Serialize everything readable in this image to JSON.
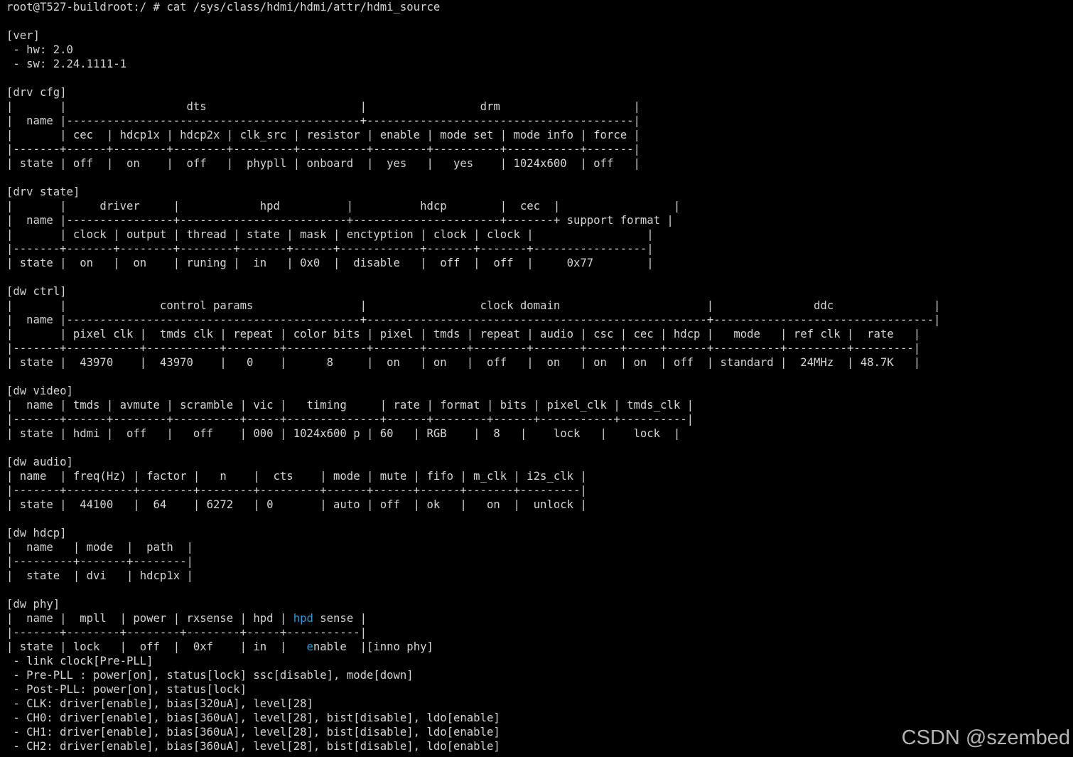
{
  "terminal": {
    "lines": [
      "root@T527-buildroot:/ # cat /sys/class/hdmi/hdmi/attr/hdmi_source",
      "",
      "[ver]",
      " - hw: 2.0",
      " - sw: 2.24.1111-1",
      "",
      "[drv cfg]",
      "|       |                  dts                       |                 drm                    |",
      "|  name |--------------------------------------------+----------------------------------------|",
      "|       | cec  | hdcp1x | hdcp2x | clk_src | resistor | enable | mode set | mode info | force |",
      "|-------+------+--------+--------+---------+----------+--------+----------+-----------+-------|",
      "| state | off  |  on    |  off   |  phypll | onboard  |  yes   |   yes    | 1024x600  | off   |",
      "",
      "[drv state]",
      "|       |     driver     |            hpd          |          hdcp        |  cec  |                 |",
      "|  name |----------------+-------------------------+----------------------+-------+ support format |",
      "|       | clock | output | thread | state | mask | enctyption | clock | clock |                 |",
      "|-------+-------+--------+--------+-------+------+------------+-------+-------+-----------------|",
      "| state |  on   |  on    | runing |  in   | 0x0  |  disable   |  off  |  off  |     0x77        |",
      "",
      "[dw ctrl]",
      "|       |              control params                |                 clock domain                      |               ddc               |",
      "|  name |--------------------------------------------+---------------------------------------------------+---------------------------------|",
      "|       | pixel clk |  tmds clk | repeat | color bits | pixel | tmds | repeat | audio | csc | cec | hdcp |   mode   | ref clk |  rate   |",
      "|-------+-----------+-----------+--------+------------+-------+------+--------+-------+-----+-----+------+----------+---------+---------|",
      "| state |  43970    |  43970    |   0    |      8     |  on   | on   |  off   |  on   | on  | on  | off  | standard |  24MHz  | 48.7K   |",
      "",
      "[dw video]",
      "|  name | tmds | avmute | scramble | vic |   timing     | rate | format | bits | pixel_clk | tmds_clk |",
      "|-------+------+--------+----------+-----+--------------+------+--------+------+-----------+----------|",
      "| state | hdmi |  off   |   off    | 000 | 1024x600 p | 60   | RGB    |  8   |    lock   |    lock  |",
      "",
      "[dw audio]",
      "| name  | freq(Hz) | factor |   n    |  cts    | mode | mute | fifo | m_clk | i2s_clk |",
      "|-------+----------+--------+--------+---------+------+------+------+-------+---------|",
      "| state |  44100   |  64    | 6272   | 0       | auto | off  | ok   |   on  |  unlock |",
      "",
      "[dw hdcp]",
      "|  name   | mode  |  path  |",
      "|---------+-------+--------|",
      "|  state  | dvi   | hdcp1x |",
      "",
      "[dw phy]",
      "|  name |  mpll  | power | rxsense | hpd | hpd sense |",
      "|-------+--------+--------+--------+-----+-----------|",
      "| state | lock   |  off  |  0xf    | in  |   enable  |[inno phy]",
      " - link clock[Pre-PLL]",
      " - Pre-PLL : power[on], status[lock] ssc[disable], mode[down]",
      " - Post-PLL: power[on], status[lock]",
      " - CLK: driver[enable], bias[320uA], level[28]",
      " - CH0: driver[enable], bias[360uA], level[28], bist[disable], ldo[enable]",
      " - CH1: driver[enable], bias[360uA], level[28], bist[disable], ldo[enable]",
      " - CH2: driver[enable], bias[360uA], level[28], bist[disable], ldo[enable]"
    ],
    "text_color": "#d4d4d4",
    "highlight_color": "#2a9bd6",
    "background": "#000000"
  },
  "watermark": {
    "text": "CSDN @szembed"
  }
}
